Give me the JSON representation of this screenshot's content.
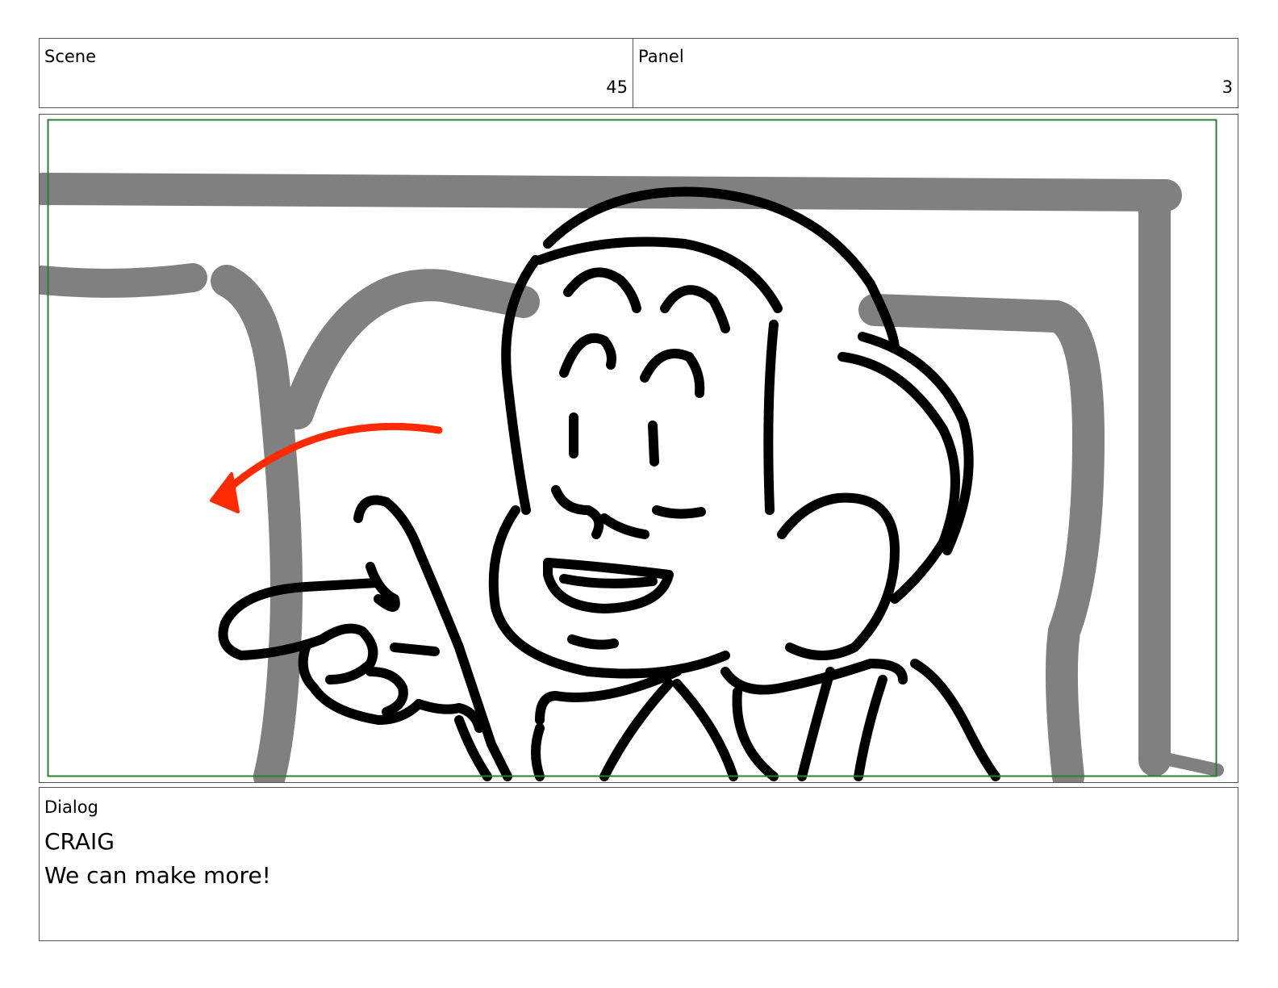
{
  "header": {
    "scene_label": "Scene",
    "scene_value": "45",
    "panel_label": "Panel",
    "panel_value": "3"
  },
  "frame": {
    "description_icon": "storyboard-sketch",
    "safe_area_color": "#2e7d32",
    "background_sketch_color": "#808080",
    "character_line_color": "#000000",
    "action_arrow_color": "#ff2a00"
  },
  "dialog": {
    "label": "Dialog",
    "character": "CRAIG",
    "line": "We can make more!"
  }
}
